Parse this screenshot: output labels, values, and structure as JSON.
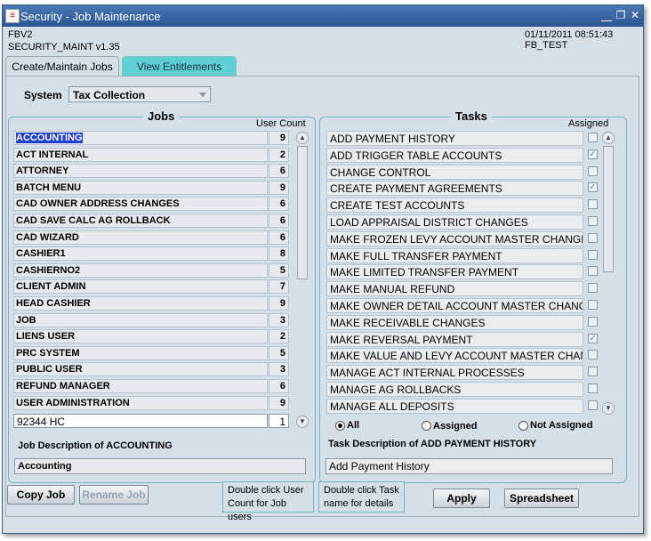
{
  "window": {
    "title": "Security - Job Maintenance",
    "app_icon": "app-icon"
  },
  "header": {
    "app_code": "FBV2",
    "module": "SECURITY_MAINT v1.35",
    "datetime": "01/11/2011 08:51:43",
    "user": "FB_TEST"
  },
  "tabs": [
    {
      "label": "Create/Maintain Jobs",
      "active": true
    },
    {
      "label": "View Entitlements",
      "active": false
    }
  ],
  "system": {
    "label": "System",
    "value": "Tax Collection"
  },
  "jobs": {
    "title": "Jobs",
    "count_header": "User Count",
    "rows": [
      {
        "name": "ACCOUNTING",
        "count": "9"
      },
      {
        "name": "ACT INTERNAL",
        "count": "2"
      },
      {
        "name": "ATTORNEY",
        "count": "6"
      },
      {
        "name": "BATCH MENU",
        "count": "9"
      },
      {
        "name": "CAD OWNER ADDRESS CHANGES",
        "count": "6"
      },
      {
        "name": "CAD SAVE CALC AG ROLLBACK",
        "count": "6"
      },
      {
        "name": "CAD WIZARD",
        "count": "6"
      },
      {
        "name": "CASHIER1",
        "count": "8"
      },
      {
        "name": "CASHIERNO2",
        "count": "5"
      },
      {
        "name": "CLIENT ADMIN",
        "count": "7"
      },
      {
        "name": "HEAD CASHIER",
        "count": "9"
      },
      {
        "name": "JOB",
        "count": "3"
      },
      {
        "name": "LIENS USER",
        "count": "2"
      },
      {
        "name": "PRC SYSTEM",
        "count": "5"
      },
      {
        "name": "PUBLIC USER",
        "count": "3"
      },
      {
        "name": "REFUND MANAGER",
        "count": "6"
      },
      {
        "name": "USER ADMINISTRATION",
        "count": "9"
      }
    ],
    "new_row": {
      "name": "92344 HC",
      "count": "1"
    },
    "desc_label": "Job Description of ACCOUNTING",
    "desc_value": "Accounting"
  },
  "tasks": {
    "title": "Tasks",
    "assigned_header": "Assigned",
    "rows": [
      {
        "name": "ADD PAYMENT HISTORY",
        "assigned": false
      },
      {
        "name": "ADD TRIGGER TABLE ACCOUNTS",
        "assigned": true
      },
      {
        "name": "CHANGE CONTROL",
        "assigned": false
      },
      {
        "name": "CREATE PAYMENT AGREEMENTS",
        "assigned": true
      },
      {
        "name": "CREATE TEST ACCOUNTS",
        "assigned": false
      },
      {
        "name": "LOAD APPRAISAL DISTRICT CHANGES",
        "assigned": false
      },
      {
        "name": "MAKE FROZEN LEVY ACCOUNT MASTER CHANGES",
        "assigned": false
      },
      {
        "name": "MAKE FULL TRANSFER PAYMENT",
        "assigned": false
      },
      {
        "name": "MAKE LIMITED TRANSFER PAYMENT",
        "assigned": false
      },
      {
        "name": "MAKE MANUAL REFUND",
        "assigned": false
      },
      {
        "name": "MAKE OWNER DETAIL ACCOUNT MASTER CHANGES",
        "assigned": false
      },
      {
        "name": "MAKE RECEIVABLE CHANGES",
        "assigned": false
      },
      {
        "name": "MAKE REVERSAL PAYMENT",
        "assigned": true
      },
      {
        "name": "MAKE VALUE AND LEVY ACCOUNT MASTER CHANGES",
        "assigned": false
      },
      {
        "name": "MANAGE ACT INTERNAL PROCESSES",
        "assigned": false
      },
      {
        "name": "MANAGE AG ROLLBACKS",
        "assigned": false
      },
      {
        "name": "MANAGE ALL DEPOSITS",
        "assigned": false
      }
    ],
    "filter": [
      {
        "label": "All",
        "selected": true
      },
      {
        "label": "Assigned",
        "selected": false
      },
      {
        "label": "Not Assigned",
        "selected": false
      }
    ],
    "desc_label": "Task Description of ADD PAYMENT HISTORY",
    "desc_value": "Add Payment History"
  },
  "buttons": {
    "copy_job": "Copy Job",
    "rename_job": "Rename Job",
    "apply": "Apply",
    "spreadsheet": "Spreadsheet"
  },
  "hints": {
    "user_count": "Double click User Count for Job users",
    "task_name": "Double click Task name for details"
  },
  "colors": {
    "title_bar": "#2a5596",
    "selection": "#1f3fcf",
    "active_tab": "#5ed0d3",
    "group_border": "#6fb7c4"
  }
}
